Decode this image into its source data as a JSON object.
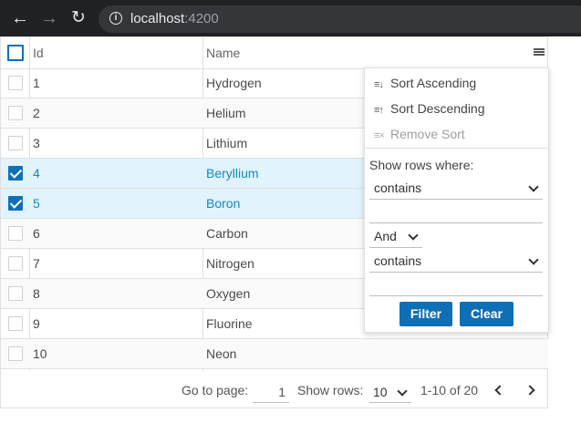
{
  "browser": {
    "url_host": "localhost",
    "url_port": ":4200",
    "back_icon": "arrow-left-icon",
    "forward_icon": "arrow-right-icon",
    "reload_icon": "reload-icon",
    "info_icon": "info-icon"
  },
  "grid": {
    "columns": {
      "id": "Id",
      "name": "Name"
    },
    "rows": [
      {
        "id": "1",
        "name": "Hydrogen",
        "selected": false
      },
      {
        "id": "2",
        "name": "Helium",
        "selected": false
      },
      {
        "id": "3",
        "name": "Lithium",
        "selected": false
      },
      {
        "id": "4",
        "name": "Beryllium",
        "selected": true
      },
      {
        "id": "5",
        "name": "Boron",
        "selected": true
      },
      {
        "id": "6",
        "name": "Carbon",
        "selected": false
      },
      {
        "id": "7",
        "name": "Nitrogen",
        "selected": false
      },
      {
        "id": "8",
        "name": "Oxygen",
        "selected": false
      },
      {
        "id": "9",
        "name": "Fluorine",
        "selected": false
      },
      {
        "id": "10",
        "name": "Neon",
        "selected": false
      }
    ],
    "selection_color": "#0f6fb6",
    "selected_row_bg": "#e1f4fd"
  },
  "pager": {
    "go_to_label": "Go to page:",
    "page_value": "1",
    "show_rows_label": "Show rows:",
    "rows_value": "10",
    "range_text": "1-10 of 20"
  },
  "column_menu": {
    "sort_ascending": "Sort Ascending",
    "sort_descending": "Sort Descending",
    "remove_sort": "Remove Sort",
    "show_rows_where": "Show rows where:",
    "condition1": "contains",
    "logic": "And",
    "condition2": "contains",
    "filter_button": "Filter",
    "clear_button": "Clear"
  }
}
